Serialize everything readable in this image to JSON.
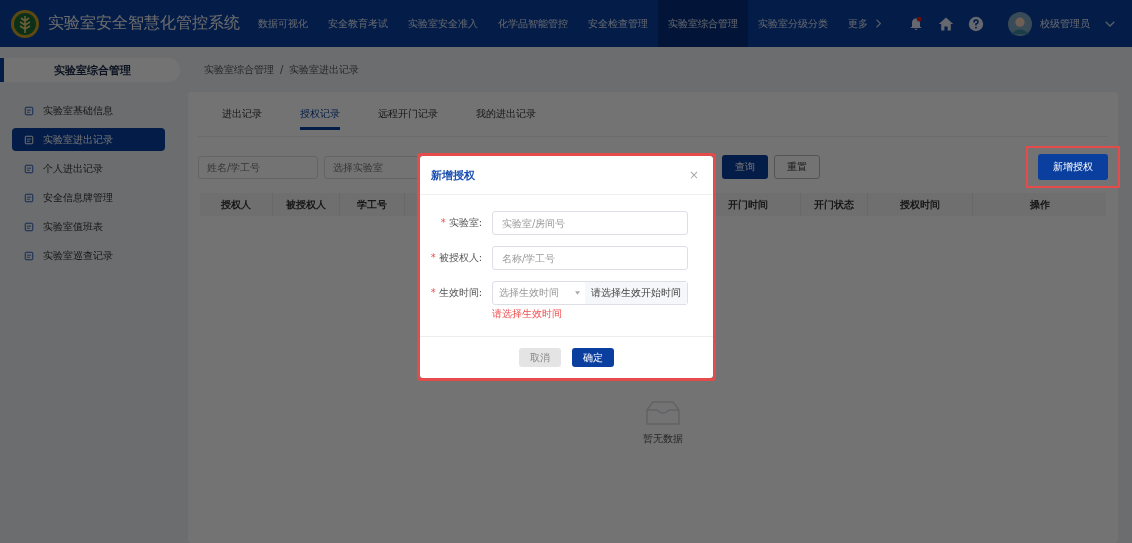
{
  "header": {
    "title": "实验室安全智慧化管控系统",
    "nav": [
      {
        "label": "数据可视化",
        "selected": false
      },
      {
        "label": "安全教育考试",
        "selected": false
      },
      {
        "label": "实验室安全准入",
        "selected": false
      },
      {
        "label": "化学品智能管控",
        "selected": false
      },
      {
        "label": "安全检查管理",
        "selected": false
      },
      {
        "label": "实验室综合管理",
        "selected": true
      },
      {
        "label": "实验室分级分类",
        "selected": false
      }
    ],
    "more": "更多",
    "notification": true,
    "user": "校级管理员"
  },
  "sidebar": {
    "title": "实验室综合管理",
    "items": [
      {
        "label": "实验室基础信息",
        "selected": false
      },
      {
        "label": "实验室进出记录",
        "selected": true
      },
      {
        "label": "个人进出记录",
        "selected": false
      },
      {
        "label": "安全信息牌管理",
        "selected": false
      },
      {
        "label": "实验室值班表",
        "selected": false
      },
      {
        "label": "实验室巡查记录",
        "selected": false
      }
    ]
  },
  "breadcrumb": [
    "实验室综合管理",
    "实验室进出记录"
  ],
  "breadcrumb_separator": "/",
  "tabs": [
    {
      "label": "进出记录",
      "selected": false
    },
    {
      "label": "授权记录",
      "selected": true
    },
    {
      "label": "远程开门记录",
      "selected": false
    },
    {
      "label": "我的进出记录",
      "selected": false
    }
  ],
  "filters": {
    "name_placeholder": "姓名/学工号",
    "lab_placeholder": "选择实验室",
    "search": "查询",
    "reset": "重置",
    "add": "新增授权",
    "add_highlighted": true
  },
  "table": {
    "columns": [
      "授权人",
      "被授权人",
      "学工号",
      "开门时间",
      "开门状态",
      "授权时间",
      "操作"
    ],
    "empty": "暂无数据"
  },
  "dialog": {
    "title": "新增授权",
    "close": "×",
    "highlighted": true,
    "required_mark": "*",
    "fields": [
      {
        "kind": "input",
        "label": "实验室:",
        "required": true,
        "placeholder": "实验室/房间号"
      },
      {
        "kind": "input",
        "label": "被授权人:",
        "required": true,
        "placeholder": "名称/学工号"
      },
      {
        "kind": "select",
        "label": "生效时间:",
        "required": true,
        "placeholder": "选择生效时间",
        "addon": "请选择生效开始时间",
        "error": "请选择生效时间"
      }
    ],
    "cancel": {
      "label": "取消",
      "disabled": true
    },
    "confirm": "确定"
  }
}
